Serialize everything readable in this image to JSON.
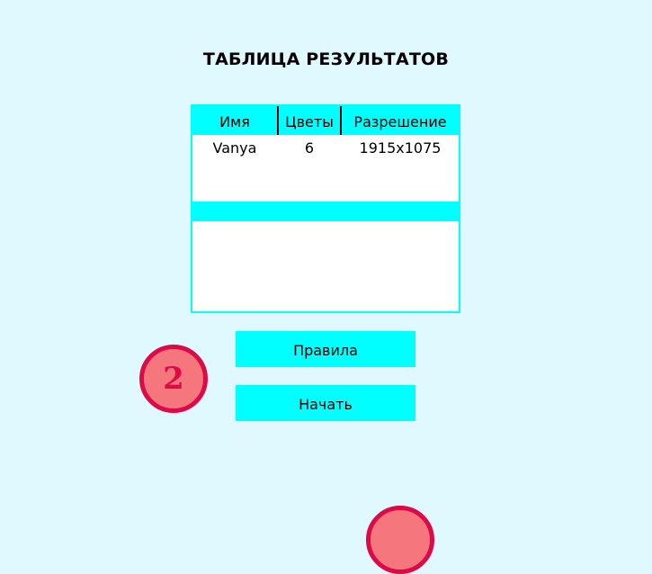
{
  "title": "ТАБЛИЦА РЕЗУЛЬТАТОВ",
  "table": {
    "headers": [
      "Имя",
      "Цветы",
      "Разрешение"
    ],
    "rows": [
      [
        "Vanya",
        "6",
        "1915x1075"
      ]
    ]
  },
  "buttons": {
    "rules": "Правила",
    "start": "Начать"
  },
  "badges": [
    {
      "label": "2"
    }
  ],
  "colors": {
    "background": "#e0f8ff",
    "accent": "#00ffff",
    "badge_border": "#dc0a46",
    "badge_fill": "#f5767c"
  }
}
